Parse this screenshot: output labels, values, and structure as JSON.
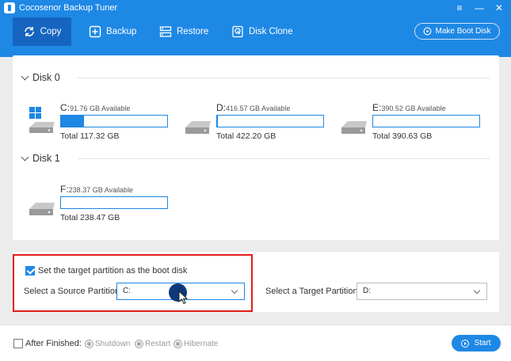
{
  "app": {
    "title": "Cocosenor Backup Tuner"
  },
  "window": {
    "menu_icon": "≡",
    "minimize_icon": "—",
    "close_icon": "✕"
  },
  "nav": {
    "items": [
      {
        "label": "Copy",
        "icon": "copy-refresh-icon"
      },
      {
        "label": "Backup",
        "icon": "backup-plus-icon"
      },
      {
        "label": "Restore",
        "icon": "restore-icon"
      },
      {
        "label": "Disk Clone",
        "icon": "disk-clone-icon"
      }
    ],
    "boot_label": "Make Boot Disk"
  },
  "disks": [
    {
      "name": "Disk 0",
      "partitions": [
        {
          "letter": "C:",
          "available": "91.76 GB Available",
          "total": "Total 117.32 GB",
          "used_fraction": 0.22,
          "system": true
        },
        {
          "letter": "D:",
          "available": "416.57 GB Available",
          "total": "Total 422.20 GB",
          "used_fraction": 0.01,
          "system": false
        },
        {
          "letter": "E:",
          "available": "390.52 GB Available",
          "total": "Total 390.63 GB",
          "used_fraction": 0.0,
          "system": false
        }
      ]
    },
    {
      "name": "Disk 1",
      "partitions": [
        {
          "letter": "F:",
          "available": "238.37 GB Available",
          "total": "Total 238.47 GB",
          "used_fraction": 0.0,
          "system": false
        }
      ]
    }
  ],
  "options": {
    "boot_checkbox_label": "Set the target partition as the boot disk",
    "boot_checked": true,
    "source_label": "Select a Source Partition:",
    "source_value": "C:",
    "target_label": "Select a Target Partition:",
    "target_value": "D:"
  },
  "footer": {
    "after_finished_label": "After Finished:",
    "after_finished_checked": false,
    "radios": [
      "Shutdown",
      "Restart",
      "Hibernate"
    ],
    "start_label": "Start"
  },
  "colors": {
    "accent": "#1e88e5",
    "highlight_box": "#e21c1c"
  }
}
